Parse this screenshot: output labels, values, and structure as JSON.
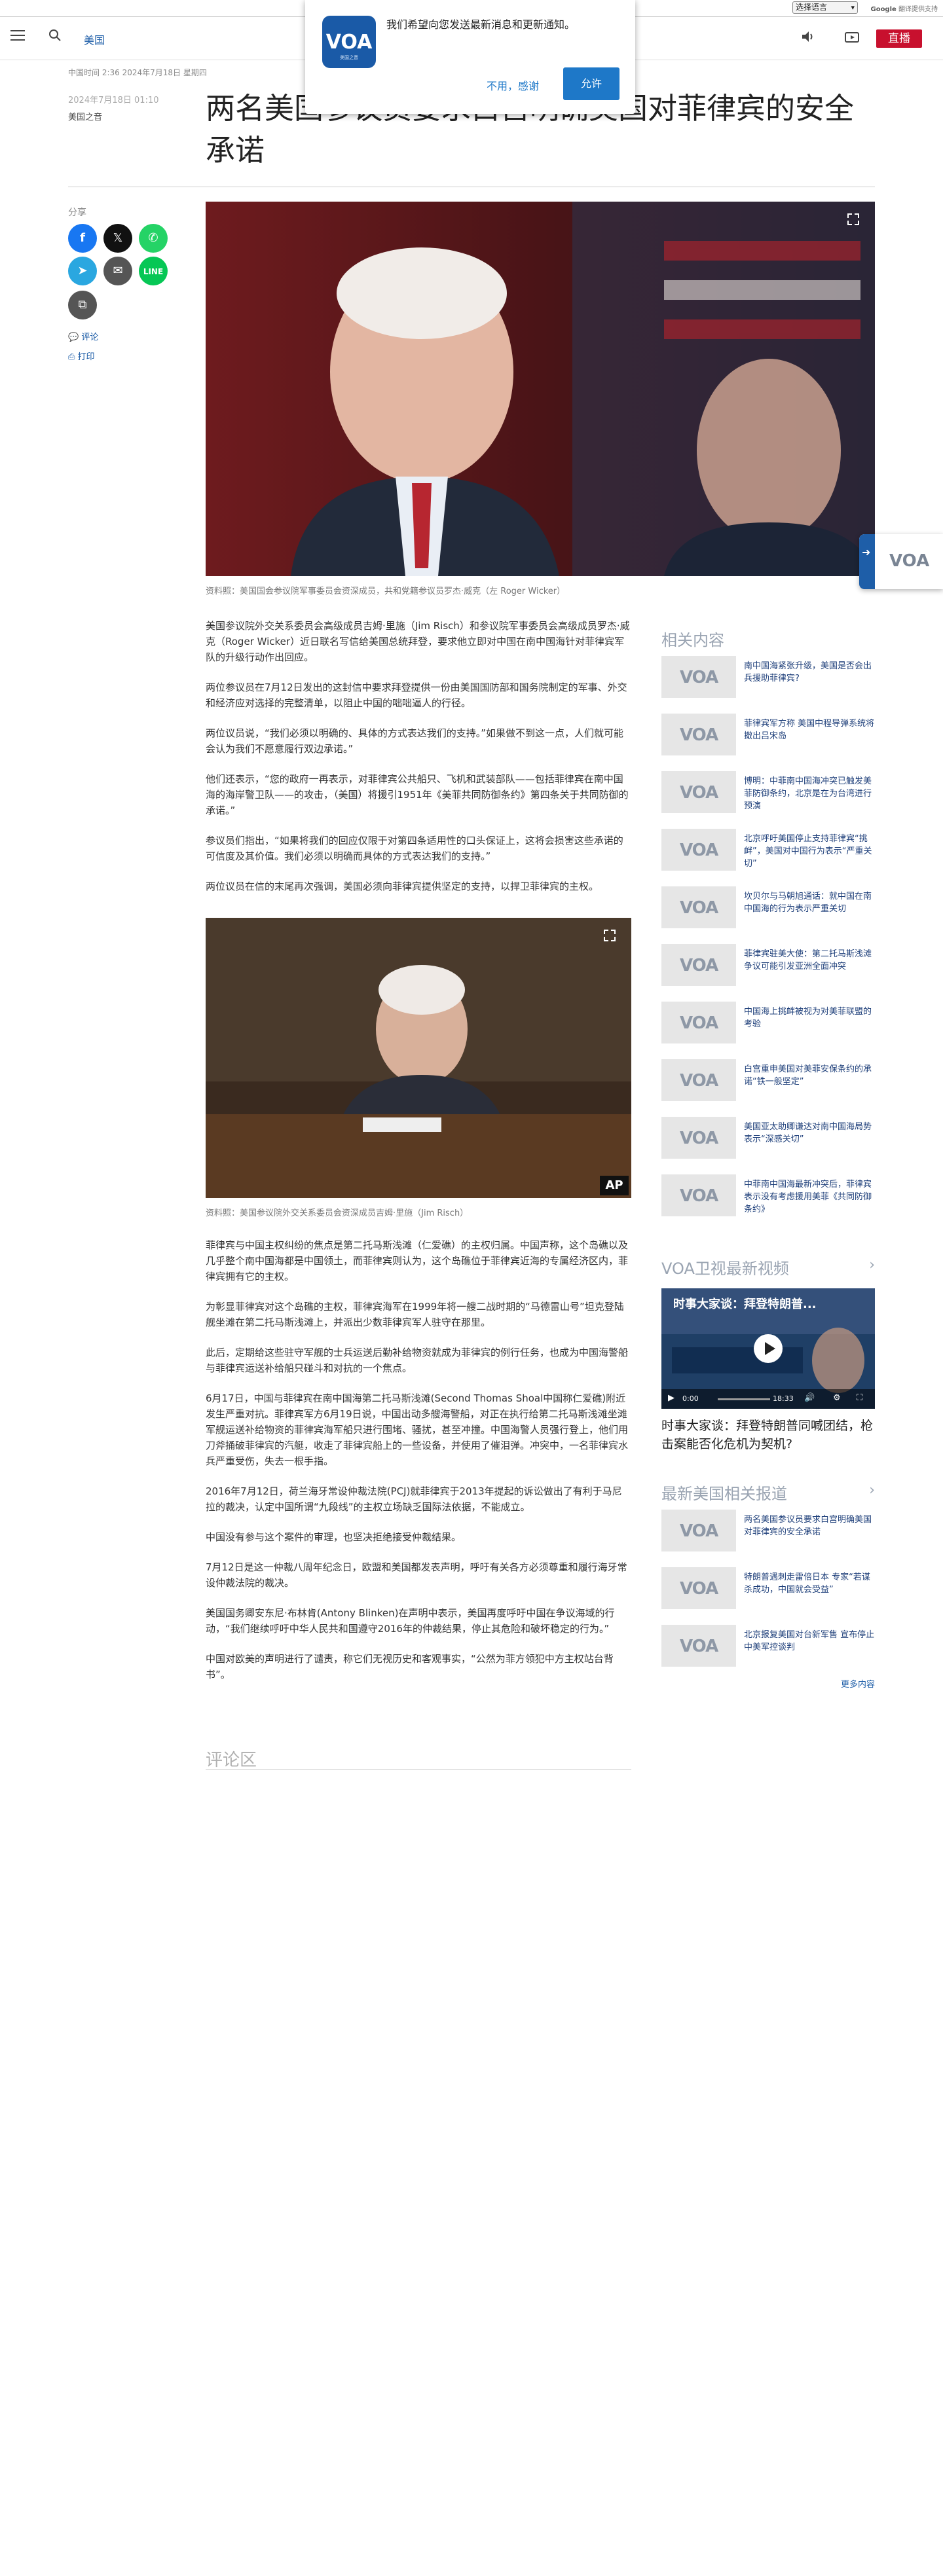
{
  "topstrip": {
    "language_select": "选择语言",
    "powered_by": "Google",
    "powered_by_label": "翻译提供支持"
  },
  "header": {
    "site_label": "美国",
    "live_label": "直播"
  },
  "notify": {
    "message": "我们希望向您发送最新消息和更新通知。",
    "deny_label": "不用，感谢",
    "allow_label": "允许"
  },
  "article": {
    "date_time": "中国时间 2:36 2024年7月18日 星期四",
    "date_updated": "2024年7月18日 01:10",
    "author": "美国之音",
    "headline": "两名美国参议员要求白宫明确美国对菲律宾的安全承诺",
    "share_label": "分享",
    "comment_link": "评论",
    "print_link": "打印",
    "hero_caption": "资料照：美国国会参议院军事委员会资深成员，共和党籍参议员罗杰·威克（左 Roger Wicker）",
    "paragraphs_1": [
      "美国参议院外交关系委员会高级成员吉姆·里施（Jim Risch）和参议院军事委员会高级成员罗杰·威克（Roger Wicker）近日联名写信给美国总统拜登，要求他立即对中国在南中国海针对菲律宾军队的升级行动作出回应。",
      "两位参议员在7月12日发出的这封信中要求拜登提供一份由美国国防部和国务院制定的军事、外交和经济应对选择的完整清单，以阻止中国的咄咄逼人的行径。",
      "两位议员说，“我们必须以明确的、具体的方式表达我们的支持。”如果做不到这一点，人们就可能会认为我们不愿意履行双边承诺。”",
      "他们还表示，“您的政府一再表示，对菲律宾公共船只、飞机和武装部队——包括菲律宾在南中国海的海岸警卫队——的攻击，（美国）将援引1951年《美菲共同防御条约》第四条关于共同防御的承诺。”",
      "参议员们指出，“如果将我们的回应仅限于对第四条适用性的口头保证上，这将会损害这些承诺的可信度及其价值。我们必须以明确而具体的方式表达我们的支持。”",
      "两位议员在信的末尾再次强调，美国必须向菲律宾提供坚定的支持，以捍卫菲律宾的主权。"
    ],
    "photo2_caption": "资料照：美国参议院外交关系委员会资深成员吉姆·里施（Jim Risch）",
    "ap_badge": "AP",
    "paragraphs_2": [
      "菲律宾与中国主权纠纷的焦点是第二托马斯浅滩（仁爱礁）的主权归属。中国声称，这个岛礁以及几乎整个南中国海都是中国领土，而菲律宾则认为，这个岛礁位于菲律宾近海的专属经济区内，菲律宾拥有它的主权。",
      "为彰显菲律宾对这个岛礁的主权，菲律宾海军在1999年将一艘二战时期的“马德雷山号”坦克登陆舰坐滩在第二托马斯浅滩上，并派出少数菲律宾军人驻守在那里。",
      "此后，定期给这些驻守军舰的士兵运送后勤补给物资就成为菲律宾的例行任务，也成为中国海警船与菲律宾运送补给船只碰斗和对抗的一个焦点。",
      "6月17日，中国与菲律宾在南中国海第二托马斯浅滩(Second Thomas Shoal中国称仁爱礁)附近发生严重对抗。菲律宾军方6月19日说，中国出动多艘海警船，对正在执行给第二托马斯浅滩坐滩军舰运送补给物资的菲律宾海军船只进行围堵、骚扰，甚至冲撞。中国海警人员强行登上，他们用刀斧捅破菲律宾的汽艇，收走了菲律宾船上的一些设备，并使用了催泪弹。冲突中，一名菲律宾水兵严重受伤，失去一根手指。",
      "2016年7月12日，荷兰海牙常设仲裁法院(PCJ)就菲律宾于2013年提起的诉讼做出了有利于马尼拉的裁决，认定中国所谓“九段线”的主权立场缺乏国际法依据，不能成立。",
      "中国没有参与这个案件的审理，也坚决拒绝接受仲裁结果。",
      "7月12日是这一仲裁八周年纪念日，欧盟和美国都发表声明，呼吁有关各方必须尊重和履行海牙常设仲裁法院的裁决。",
      "美国国务卿安东尼·布林肯(Antony Blinken)在声明中表示，美国再度呼吁中国在争议海域的行动，“我们继续呼吁中华人民共和国遵守2016年的仲裁结果，停止其危险和破坏稳定的行为。”",
      "中国对欧美的声明进行了谴责，称它们无视历史和客观事实，“公然为菲方领犯中方主权站台背书”。"
    ],
    "comments_title": "评论区"
  },
  "sidebar": {
    "related_title": "相关内容",
    "related": [
      "南中国海紧张升级，美国是否会出兵援助菲律宾?",
      "菲律宾军方称 美国中程导弹系统将撤出吕宋岛",
      "博明：中菲南中国海冲突已触发美菲防御条约，北京是在为台湾进行预演",
      "北京呼吁美国停止支持菲律宾“挑衅”，美国对中国行为表示“严重关切”",
      "坎贝尔与马朝旭通话：就中国在南中国海的行为表示严重关切",
      "菲律宾驻美大使：第二托马斯浅滩争议可能引发亚洲全面冲突",
      "中国海上挑衅被视为对美菲联盟的考验",
      "白宫重申美国对美菲安保条约的承诺“铁一般坚定”",
      "美国亚太助卿谦达对南中国海局势表示“深感关切”",
      "中菲南中国海最新冲突后，菲律宾表示没有考虑援用美菲《共同防御条约》"
    ],
    "video_title": "VOA卫视最新视频",
    "video_overlay_title": "时事大家谈：拜登特朗普...",
    "video_time": "0:00",
    "video_duration": "18:33",
    "video_caption": "时事大家谈：拜登特朗普同喊团结，枪击案能否化危机为契机?",
    "latest_title": "最新美国相关报道",
    "latest": [
      "两名美国参议员要求白宫明确美国对菲律宾的安全承诺",
      "特朗普遇刺走雷倍日本 专家“若谋杀成功，中国就会受益”",
      "北京报复美国对台新军售 宣布停止中美军控谈判"
    ],
    "more_label": "更多内容"
  },
  "float_logo": "VOA",
  "colors": {
    "accent": "#1e5ea8",
    "live": "#c8102e"
  }
}
